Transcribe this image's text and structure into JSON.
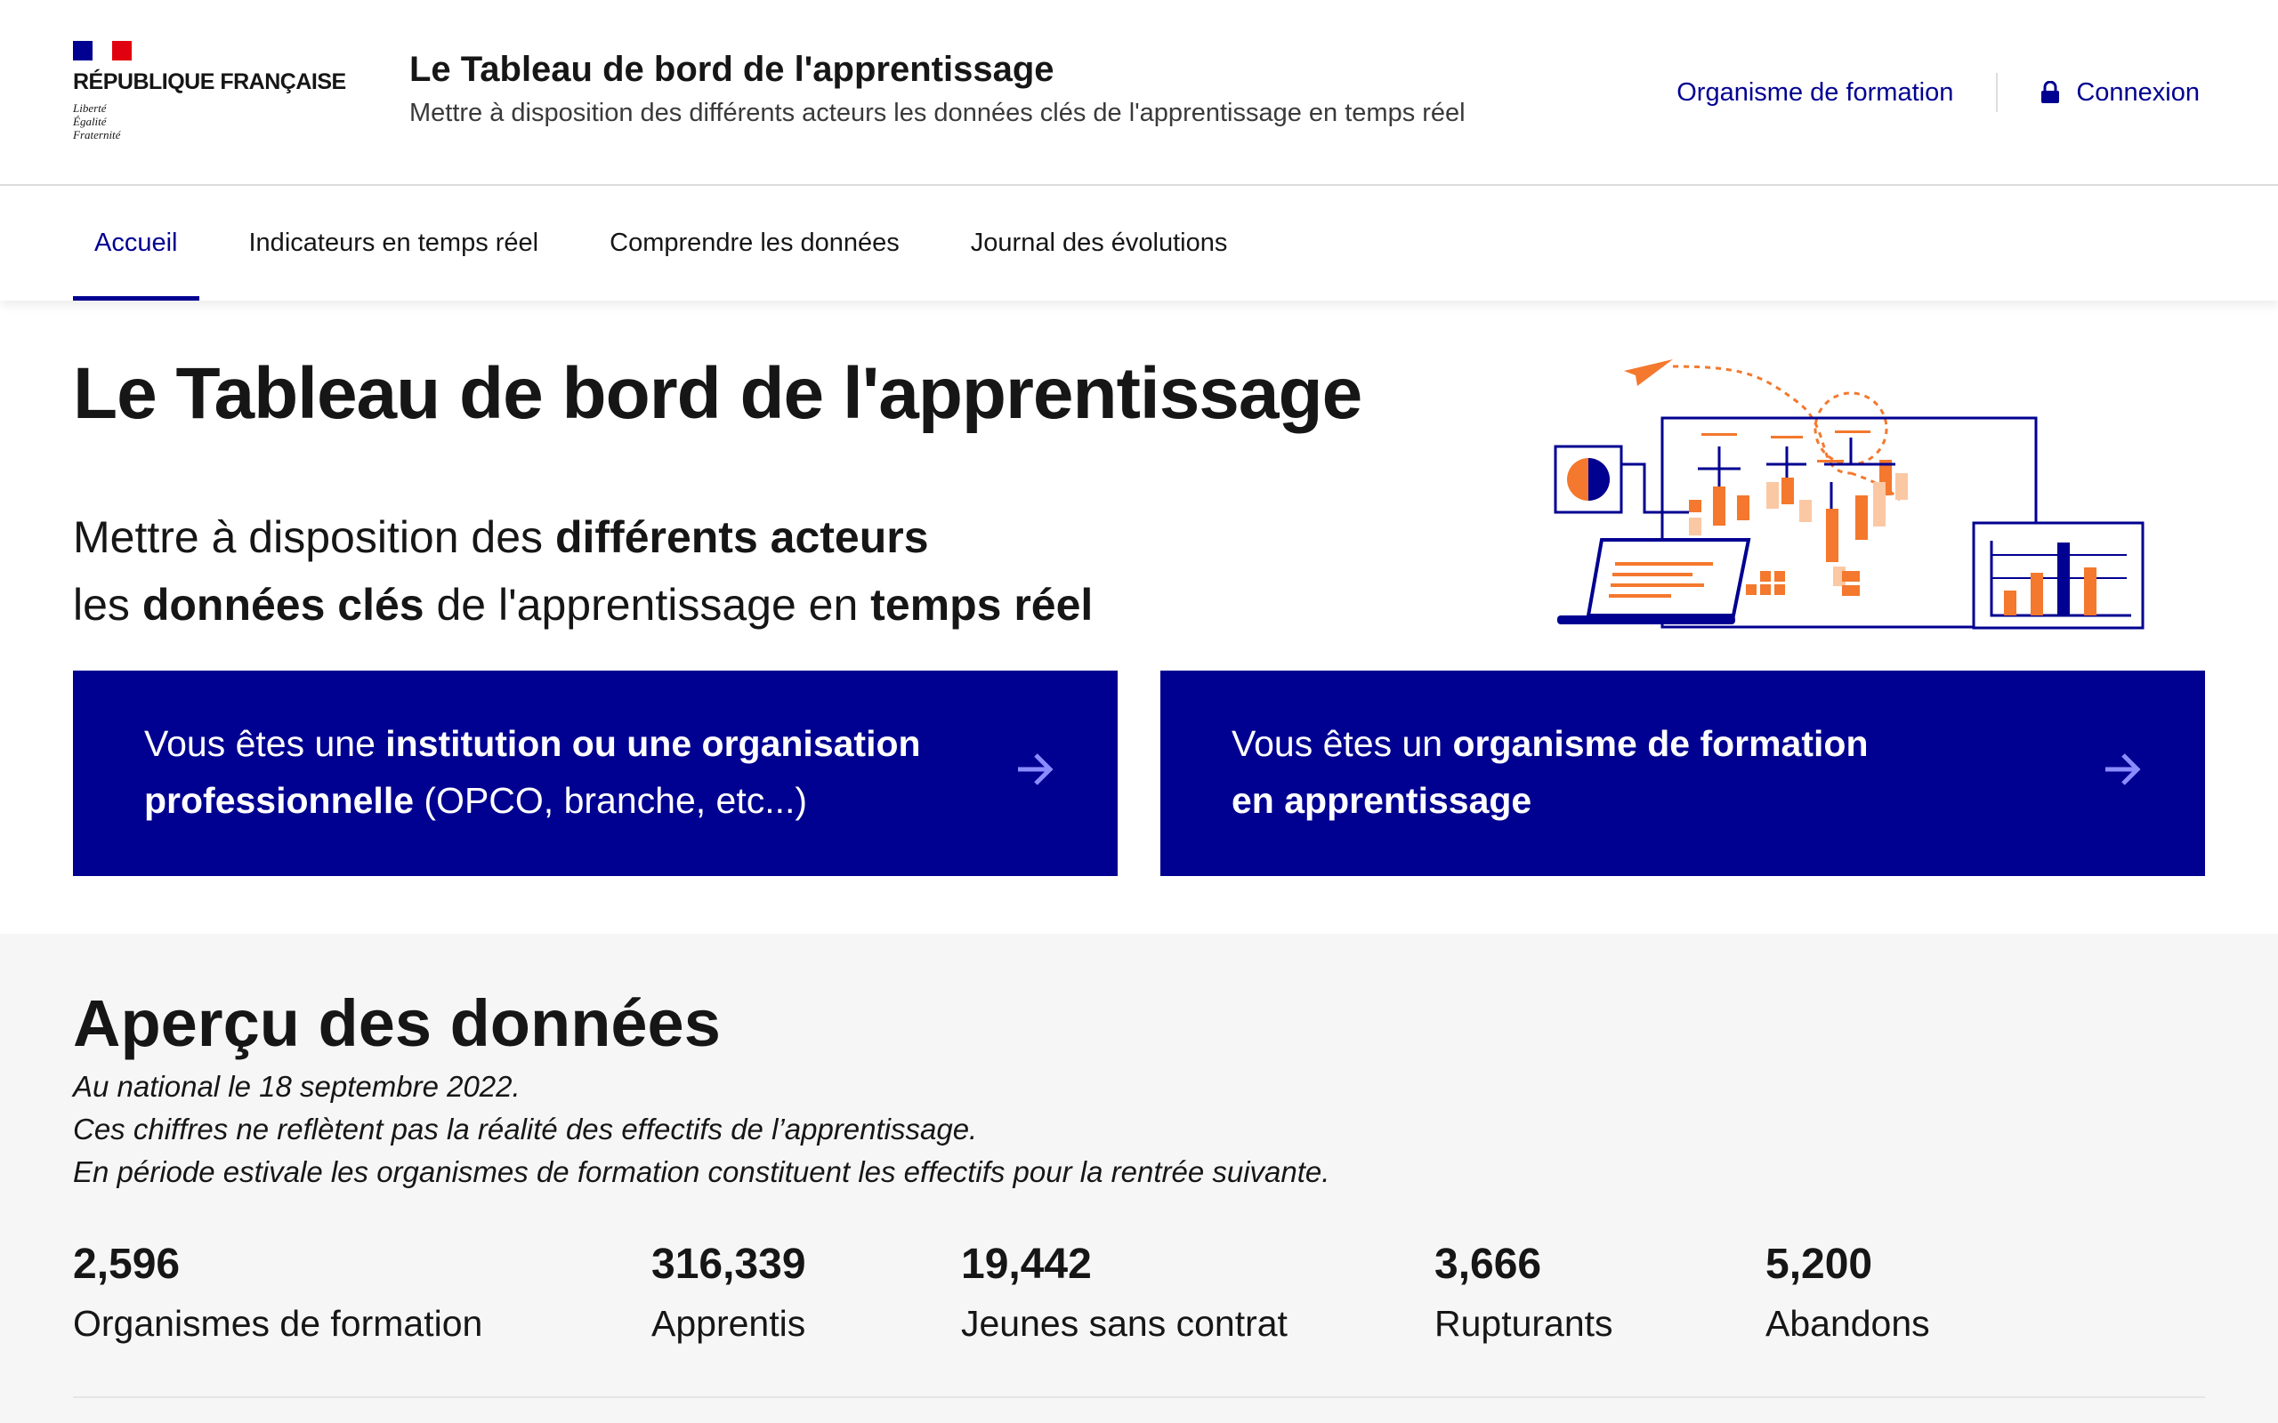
{
  "header": {
    "brand": {
      "name": "RÉPUBLIQUE FRANÇAISE",
      "motto": [
        "Liberté",
        "Égalité",
        "Fraternité"
      ]
    },
    "service_title": "Le Tableau de bord de l'apprentissage",
    "service_tagline": "Mettre à disposition des différents acteurs les données clés de l'apprentissage en temps réel",
    "tools": {
      "organisme_link": "Organisme de formation",
      "login_link": "Connexion"
    }
  },
  "nav": {
    "items": [
      {
        "label": "Accueil",
        "active": true
      },
      {
        "label": "Indicateurs en temps réel",
        "active": false
      },
      {
        "label": "Comprendre les données",
        "active": false
      },
      {
        "label": "Journal des évolutions",
        "active": false
      }
    ]
  },
  "hero": {
    "title": "Le Tableau de bord de l'apprentissage",
    "subtitle": {
      "line1_a": "Mettre à disposition des ",
      "line1_b": "différents acteurs",
      "line2_a": "les ",
      "line2_b": "données clés",
      "line2_c": " de l'apprentissage en ",
      "line2_d": "temps réel"
    }
  },
  "cards": [
    {
      "line1_a": "Vous êtes une ",
      "line1_b": "institution ou une organisation",
      "line2_a": "professionnelle",
      "line2_b": " (OPCO, branche, etc...)"
    },
    {
      "line1_a": "Vous êtes un ",
      "line1_b": "organisme de formation",
      "line2_a": "en apprentissage",
      "line2_b": ""
    }
  ],
  "data_overview": {
    "title": "Aperçu des données",
    "notes": [
      "Au national le 18 septembre 2022.",
      "Ces chiffres ne reflètent pas la réalité des effectifs de l’apprentissage.",
      "En période estivale les organismes de formation constituent les effectifs pour la rentrée suivante."
    ],
    "stats": [
      {
        "value": "2,596",
        "label": "Organismes de formation"
      },
      {
        "value": "316,339",
        "label": "Apprentis"
      },
      {
        "value": "19,442",
        "label": "Jeunes sans contrat"
      },
      {
        "value": "3,666",
        "label": "Rupturants"
      },
      {
        "value": "5,200",
        "label": "Abandons"
      }
    ]
  },
  "colors": {
    "primary": "#000091",
    "accent_orange": "#f4782d",
    "accent_light": "#fbc8a4",
    "marianne_red": "#e1000f",
    "section_bg": "#f6f6f6"
  },
  "icons": {
    "login": "lock-icon",
    "card_cta": "arrow-right-icon",
    "illustration": "dashboard-illustration"
  }
}
